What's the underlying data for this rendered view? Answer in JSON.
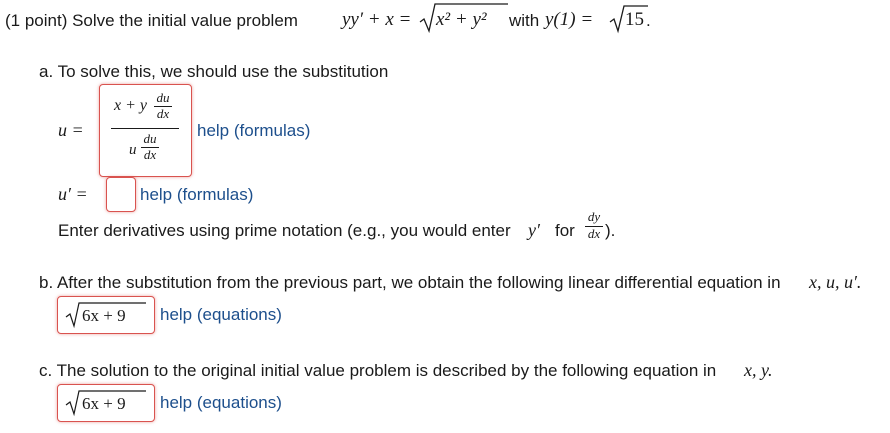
{
  "header": {
    "points": "(1 point) Solve the initial value problem",
    "eq_lhs": "yy′ + x =",
    "radicand": "x² + y²",
    "with": "with",
    "cond_lhs": "y(1) =",
    "cond_rad": "15",
    "period": "."
  },
  "part_a": {
    "label": "a. To solve this, we should use the substitution",
    "u_label": "u =",
    "answer1": {
      "num_left": "x + y",
      "num_frac_top": "du",
      "num_frac_bot": "dx",
      "den_left": "u",
      "den_frac_top": "du",
      "den_frac_bot": "dx"
    },
    "help_formulas_1": "help (formulas)",
    "uprime_label": "u′ =",
    "answer2_value": "",
    "help_formulas_2": "help (formulas)",
    "note_text": "Enter derivatives using prime notation (e.g., you would enter",
    "note_yprime": "y′",
    "note_for": "for",
    "note_dy": "dy",
    "note_dx": "dx",
    "note_close": ")."
  },
  "part_b": {
    "label": "b. After the substitution from the previous part, we obtain the following linear differential equation in",
    "vars": "x, u, u′.",
    "answer_rad": "6x + 9",
    "help_equations": "help (equations)"
  },
  "part_c": {
    "label": "c. The solution to the original initial value problem is described by the following equation in",
    "vars": "x, y.",
    "answer_rad": "6x + 9",
    "help_equations": "help (equations)"
  },
  "colors": {
    "box_border": "#d9534f",
    "link": "#1d4f8c"
  }
}
